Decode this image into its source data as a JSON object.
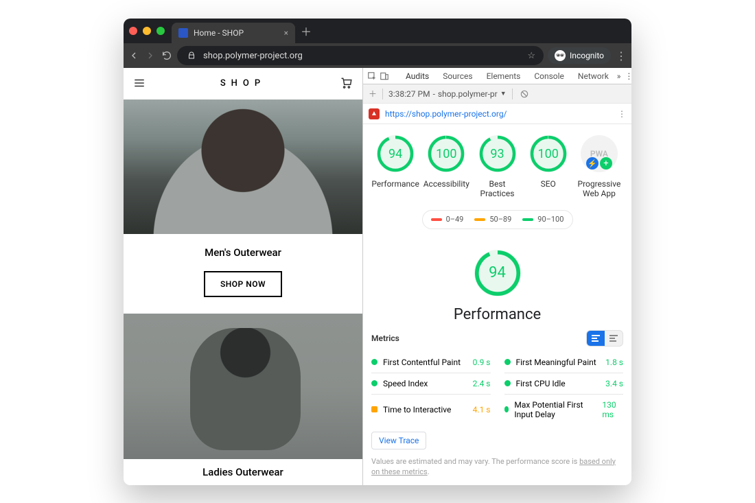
{
  "domain": "Computer-Use",
  "browser": {
    "tab_title": "Home - SHOP",
    "url_display": "shop.polymer-project.org",
    "incognito_label": "Incognito"
  },
  "site": {
    "brand": "SHOP",
    "section1_title": "Men's Outerwear",
    "shop_now": "SHOP NOW",
    "section2_title": "Ladies Outerwear"
  },
  "devtools": {
    "tabs": [
      "Audits",
      "Sources",
      "Elements",
      "Console",
      "Network"
    ],
    "active_tab": "Audits",
    "timestamp": "3:38:27 PM",
    "run_select": "shop.polymer-pr",
    "audited_url": "https://shop.polymer-project.org/",
    "scores": [
      {
        "label": "Performance",
        "value": 94,
        "color": "green"
      },
      {
        "label": "Accessibility",
        "value": 100,
        "color": "green"
      },
      {
        "label": "Best Practices",
        "value": 93,
        "color": "green"
      },
      {
        "label": "SEO",
        "value": 100,
        "color": "green"
      }
    ],
    "pwa_label": "Progressive Web App",
    "legend": [
      {
        "range": "0–49",
        "color": "red"
      },
      {
        "range": "50–89",
        "color": "orange"
      },
      {
        "range": "90–100",
        "color": "green"
      }
    ],
    "big_score": {
      "label": "Performance",
      "value": 94
    },
    "metrics_title": "Metrics",
    "metrics": [
      {
        "name": "First Contentful Paint",
        "value": "0.9 s",
        "level": "green"
      },
      {
        "name": "First Meaningful Paint",
        "value": "1.8 s",
        "level": "green"
      },
      {
        "name": "Speed Index",
        "value": "2.4 s",
        "level": "green"
      },
      {
        "name": "First CPU Idle",
        "value": "3.4 s",
        "level": "green"
      },
      {
        "name": "Time to Interactive",
        "value": "4.1 s",
        "level": "orange"
      },
      {
        "name": "Max Potential First Input Delay",
        "value": "130 ms",
        "level": "green"
      }
    ],
    "view_trace": "View Trace",
    "disclaimer_a": "Values are estimated and may vary. The performance score is ",
    "disclaimer_link": "based only on these metrics",
    "disclaimer_b": "."
  },
  "chart_data": {
    "type": "table",
    "title": "Lighthouse audit scores",
    "categories": [
      "Performance",
      "Accessibility",
      "Best Practices",
      "SEO"
    ],
    "values": [
      94,
      100,
      93,
      100
    ],
    "ylim": [
      0,
      100
    ]
  }
}
